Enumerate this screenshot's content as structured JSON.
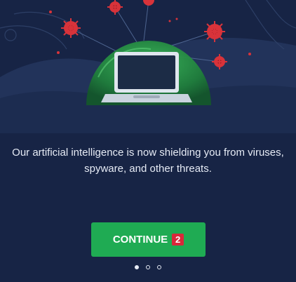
{
  "hero": {
    "illustration": "laptop-shielded-by-green-dome-with-viruses"
  },
  "message": {
    "line1": "Our artificial intelligence is now shielding you from viruses,",
    "line2": "spyware, and other threats."
  },
  "continue_button": {
    "label": "CONTINUE",
    "step_badge": "2"
  },
  "pagination": {
    "total": 3,
    "active": 1
  },
  "colors": {
    "background": "#172445",
    "accent_green": "#1fab53",
    "badge_red": "#d9283a",
    "virus_red": "#d8333a",
    "dome_green": "#2a9d4a"
  }
}
